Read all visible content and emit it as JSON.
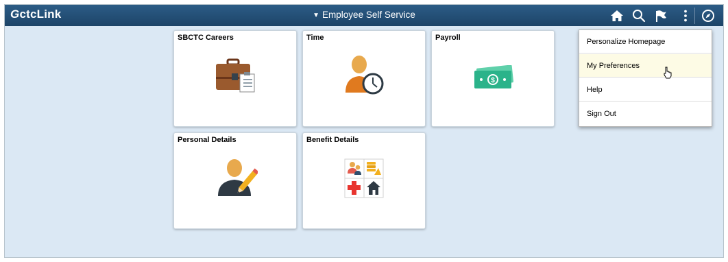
{
  "header": {
    "logo_text": "ctcLink",
    "logo_mark": "G",
    "title": "Employee Self Service",
    "caret": "▼",
    "icons": [
      "home-icon",
      "search-icon",
      "flag-icon",
      "more-actions-icon",
      "navbar-compass-icon"
    ]
  },
  "tiles": [
    {
      "label": "SBCTC Careers",
      "icon": "briefcase-icon"
    },
    {
      "label": "Time",
      "icon": "person-clock-icon"
    },
    {
      "label": "Payroll",
      "icon": "money-icon"
    },
    {
      "label": "Personal Details",
      "icon": "person-pencil-icon"
    },
    {
      "label": "Benefit Details",
      "icon": "benefits-grid-icon"
    }
  ],
  "menu": {
    "items": [
      {
        "label": "Personalize Homepage"
      },
      {
        "label": "My Preferences"
      },
      {
        "label": "Help"
      },
      {
        "label": "Sign Out"
      }
    ]
  },
  "colors": {
    "header": "#1d4468",
    "background": "#dbe8f4",
    "menu_highlight": "#fdfbe5",
    "payroll_green": "#2bb38a",
    "briefcase_brown": "#8b4b25"
  }
}
